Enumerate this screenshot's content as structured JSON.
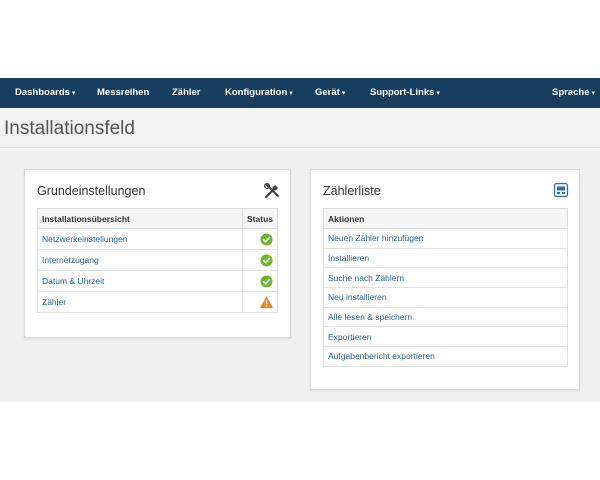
{
  "nav": {
    "items": [
      {
        "label": "Dashboards",
        "caret": "▾"
      },
      {
        "label": "Messreihen",
        "caret": ""
      },
      {
        "label": "Zähler",
        "caret": ""
      },
      {
        "label": "Konfiguration",
        "caret": "▾"
      },
      {
        "label": "Gerät",
        "caret": "▾"
      },
      {
        "label": "Support-Links",
        "caret": "▾"
      }
    ],
    "language": {
      "label": "Sprache",
      "caret": "▾"
    }
  },
  "page": {
    "title": "Installationsfeld"
  },
  "left_panel": {
    "title": "Grundeinstellungen",
    "icon": "tools-icon",
    "columns": [
      "Installationsübersicht",
      "Status"
    ],
    "rows": [
      {
        "label": "Netzwerkeinstellungen",
        "status": "ok",
        "status_color": "#6bb82b"
      },
      {
        "label": "Internetzugang",
        "status": "ok",
        "status_color": "#6bb82b"
      },
      {
        "label": "Datum & Uhrzeit",
        "status": "ok",
        "status_color": "#6bb82b"
      },
      {
        "label": "Zähler",
        "status": "warning",
        "status_color": "#e8821c"
      }
    ]
  },
  "right_panel": {
    "title": "Zählerliste",
    "icon": "meter-list-icon",
    "header": "Aktionen",
    "actions": [
      "Neuen Zähler hinzufügen",
      "Installieren",
      "Suche nach Zählern",
      "Neu installieren",
      "Alle lesen & speichern",
      "Exportieren",
      "Aufgabenbericht exportieren"
    ]
  },
  "colors": {
    "navbar": "#173e5e",
    "link": "#2a6496",
    "ok": "#6bb82b",
    "warning": "#e8821c"
  }
}
